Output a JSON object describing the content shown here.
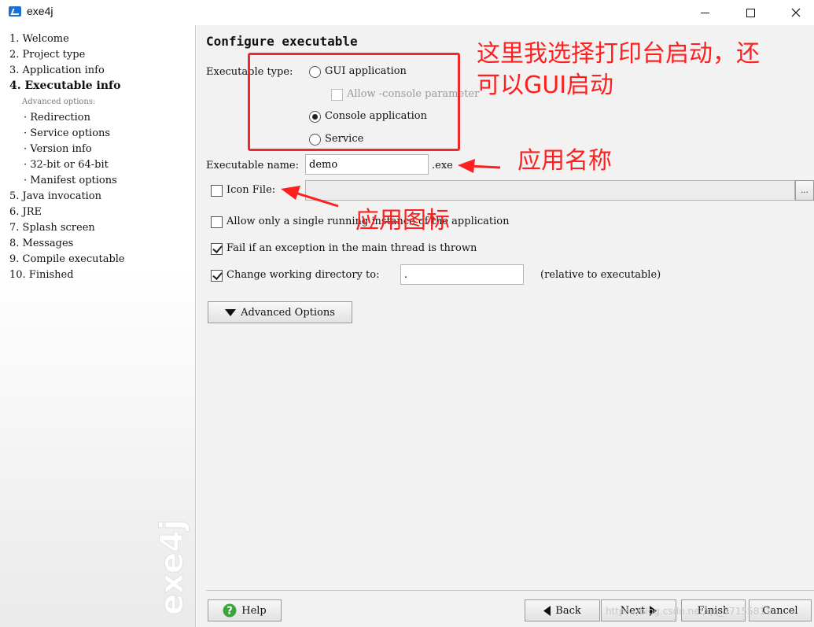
{
  "window": {
    "title": "exe4j"
  },
  "sidebar": {
    "steps": [
      {
        "label": "1. Welcome"
      },
      {
        "label": "2. Project type"
      },
      {
        "label": "3. Application info"
      },
      {
        "label": "4. Executable info"
      },
      {
        "label": "5. Java invocation"
      },
      {
        "label": "6. JRE"
      },
      {
        "label": "7. Splash screen"
      },
      {
        "label": "8. Messages"
      },
      {
        "label": "9. Compile executable"
      },
      {
        "label": "10. Finished"
      }
    ],
    "advanced_caption": "Advanced options:",
    "sub_steps": [
      {
        "label": "· Redirection"
      },
      {
        "label": "· Service options"
      },
      {
        "label": "· Version info"
      },
      {
        "label": "· 32-bit or 64-bit"
      },
      {
        "label": "· Manifest options"
      }
    ],
    "watermark": "exe4j"
  },
  "main": {
    "title": "Configure executable",
    "exec_type_label": "Executable type:",
    "options": {
      "gui": "GUI application",
      "allow_console": "Allow -console parameter",
      "console": "Console application",
      "service": "Service"
    },
    "selected_type": "Console application",
    "exec_name_label": "Executable name:",
    "exec_name_value": "demo",
    "exe_suffix": ".exe",
    "icon_file_label": "Icon File:",
    "icon_file_value": "",
    "browse_label": "...",
    "single_instance_label": "Allow only a single running instance of the application",
    "fail_exception_label": "Fail if an exception in the main thread is thrown",
    "change_dir_label": "Change working directory to:",
    "change_dir_value": ".",
    "relative_label": "(relative to executable)",
    "advanced_button": "Advanced Options"
  },
  "footer": {
    "help": "Help",
    "back": "Back",
    "next": "Next",
    "finish": "Finish",
    "cancel": "Cancel",
    "url_watermark": "https://blog.csdn.net/qq_37155811"
  },
  "annotations": {
    "top": "这里我选择打印台启动，还",
    "top2": "可以GUI启动",
    "name": "应用名称",
    "icon": "应用图标"
  },
  "colors": {
    "annotation": "#ff1f1f",
    "help_icon": "#3aa63a",
    "app_icon": "#1f6fd0"
  }
}
